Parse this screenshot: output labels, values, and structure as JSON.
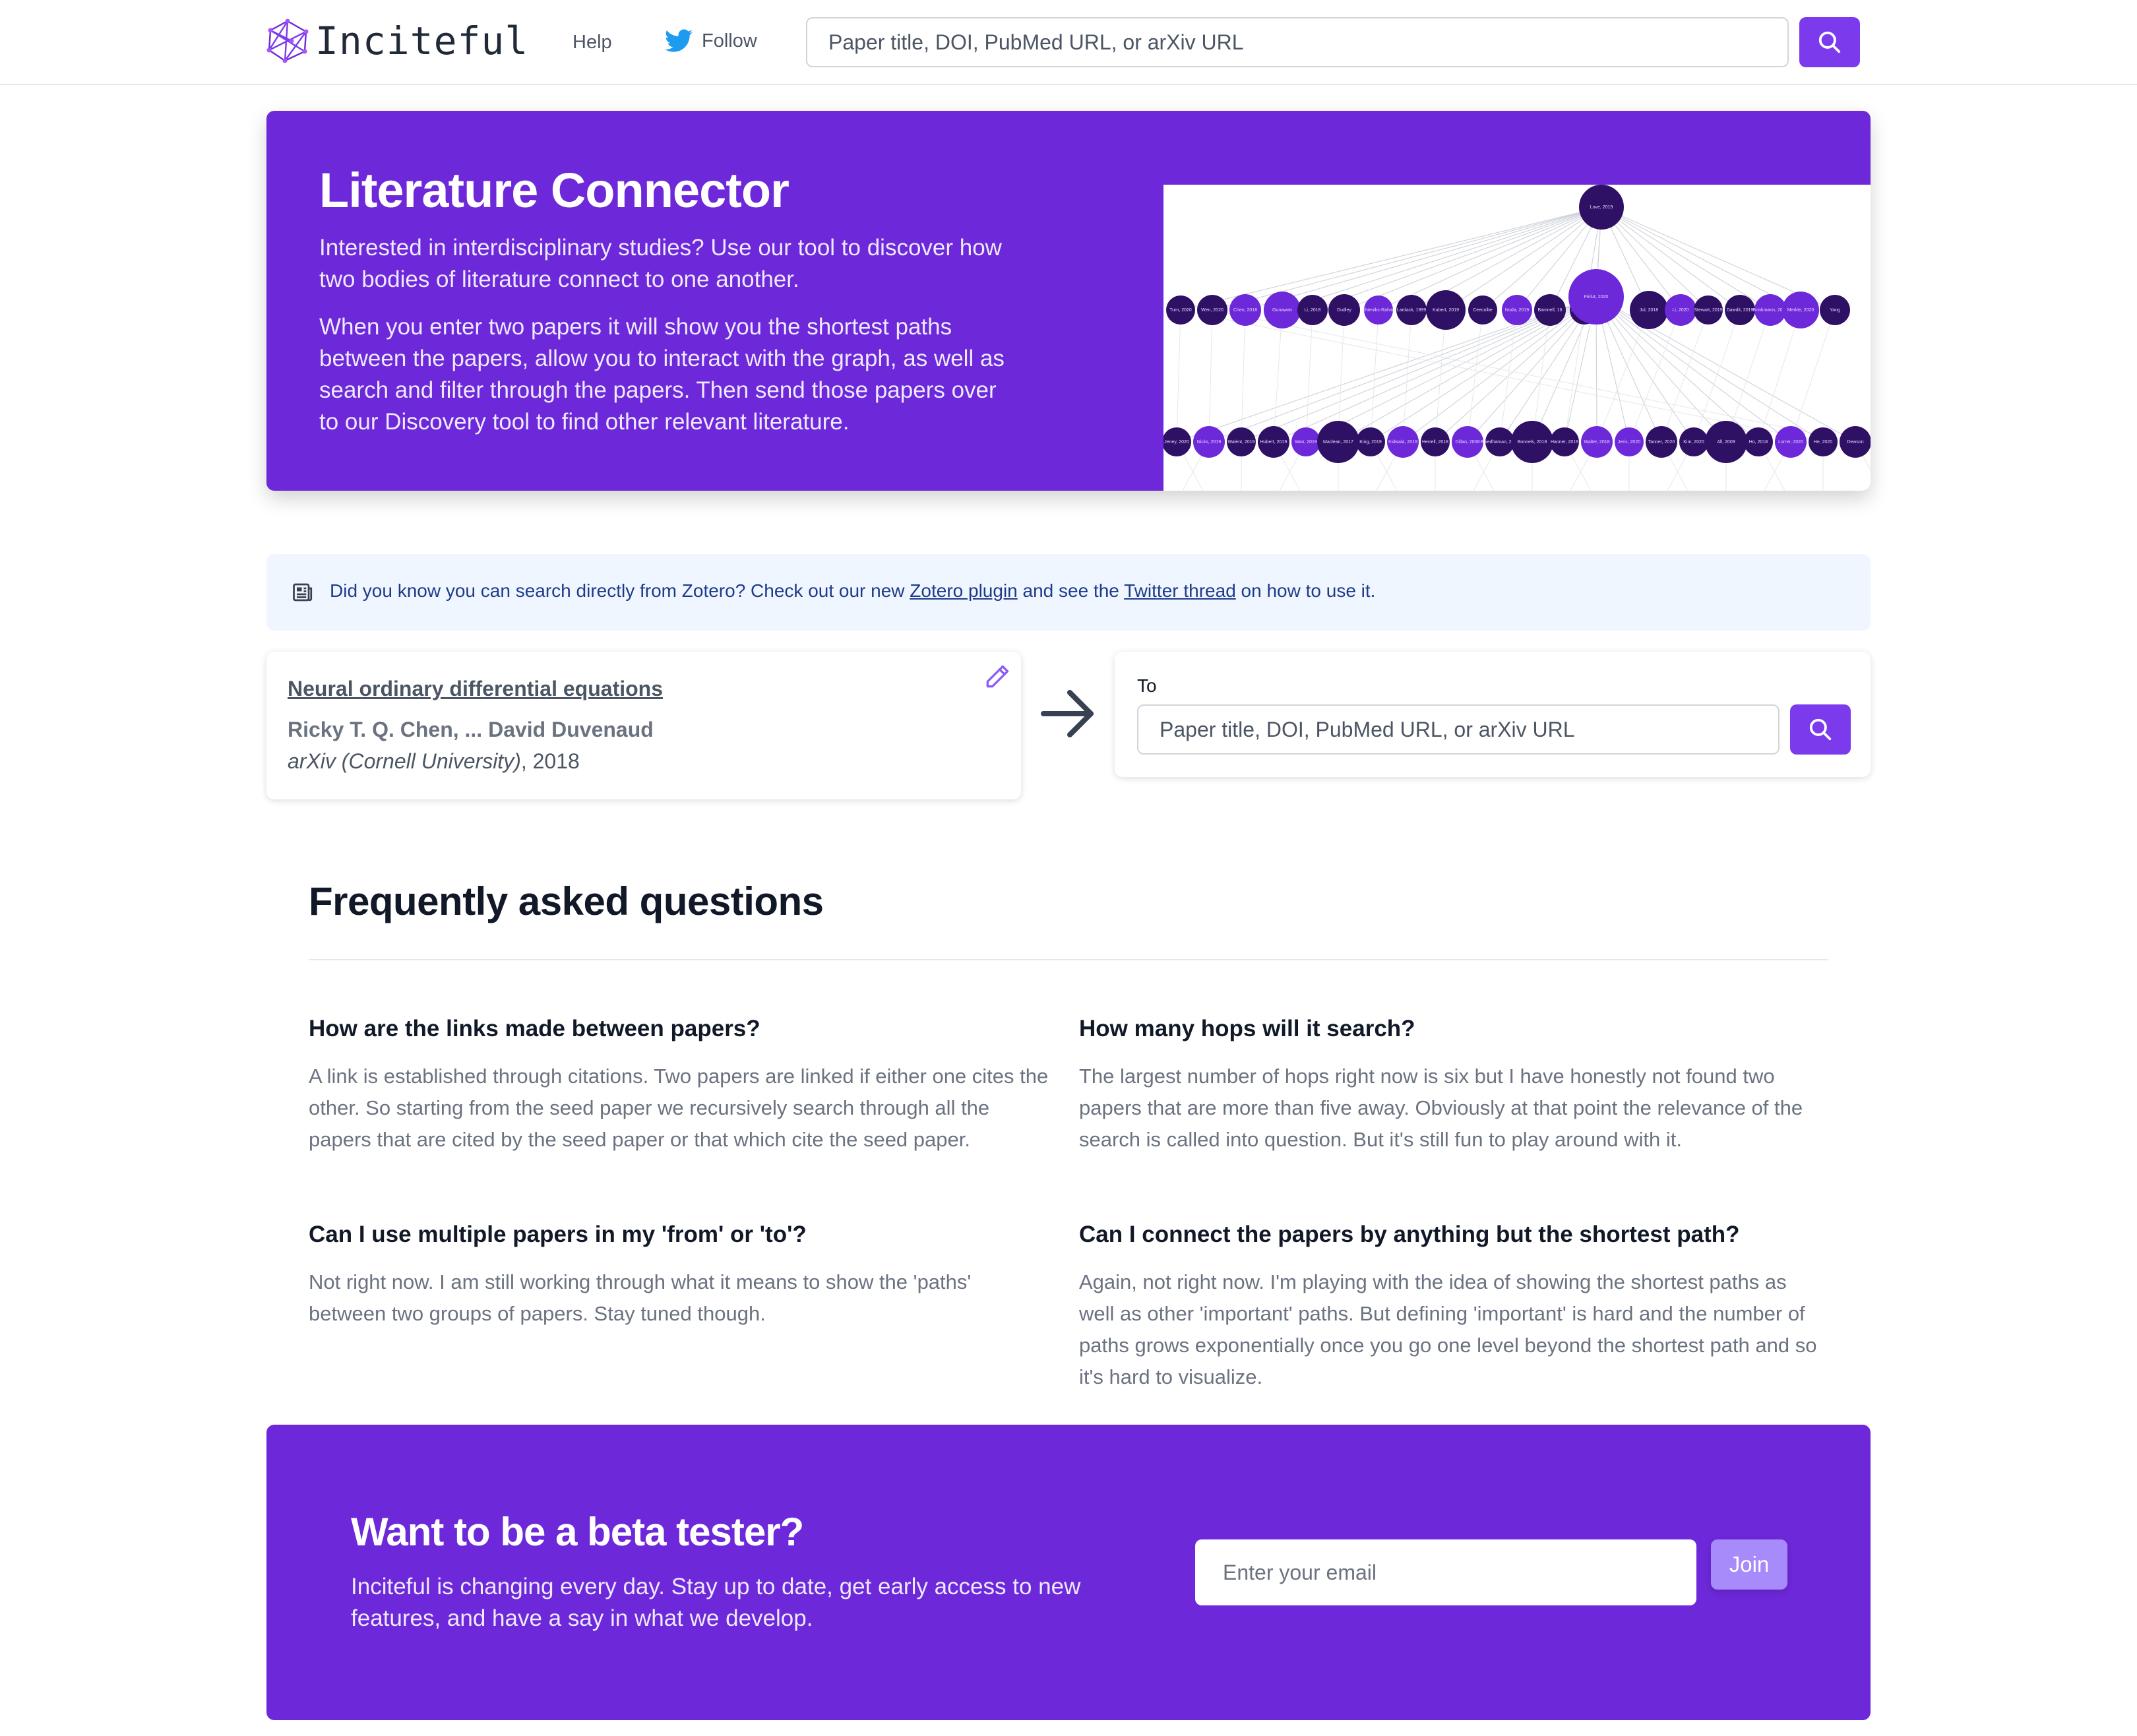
{
  "header": {
    "logo_text": "Inciteful",
    "help_label": "Help",
    "follow_label": "Follow",
    "search_placeholder": "Paper title, DOI, PubMed URL, or arXiv URL"
  },
  "hero": {
    "title": "Literature Connector",
    "p1": "Interested in interdisciplinary studies? Use our tool to discover how two bodies of literature connect to one another.",
    "p2": "When you enter two papers it will show you the shortest paths between the papers, allow you to interact with the graph, as well as search and filter through the papers. Then send those papers over to our Discovery tool to find other relevant literature.",
    "graph": {
      "top_node": "Love, 2019",
      "hub_node": "Finlut, 2020",
      "row1_labels": [
        "Turn, 2020",
        "Wen, 2020",
        "Chen, 2018",
        "Gunawan",
        "Li, 2018",
        "Dudley",
        "Shieniks-Rahari",
        "Lardack, 1999",
        "Kubert, 2019",
        "Ceecolbe",
        "Noda, 2019",
        "Bamnell, 16",
        "James, 2019",
        "Jul, 2018",
        "Li, 2020",
        "Stewart, 2019",
        "Dawdit, 2019",
        "Brinkmann, 2018",
        "Merkle, 2020",
        "Yang"
      ],
      "row2_labels": [
        "Jeney, 2020",
        "Nicks, 2019",
        "Walent, 2019",
        "Hubert, 2019",
        "Wan, 2019",
        "Maclean, 2017",
        "King, 2019",
        "Kidwala, 2019",
        "Herrell, 2018",
        "Dillan, 2008",
        "Buiedhaman, 2008",
        "Bonnels, 2018",
        "Hanner, 2019",
        "Walter, 2018",
        "Jeris, 2020",
        "Tanner, 2020",
        "Kim, 2020",
        "All, 2009",
        "Ho, 2018",
        "Lorrer, 2020",
        "He, 2020",
        "Dewson"
      ]
    }
  },
  "alert": {
    "text_before": "Did you know you can search directly from Zotero? Check out our new ",
    "link1": "Zotero plugin",
    "text_middle": " and see the ",
    "link2": "Twitter thread",
    "text_after": " on how to use it."
  },
  "from_paper": {
    "title": "Neural ordinary differential equations",
    "authors": "Ricky T. Q. Chen, ... David Duvenaud",
    "venue": "arXiv (Cornell University)",
    "year_suffix": ", 2018"
  },
  "to_box": {
    "label": "To",
    "placeholder": "Paper title, DOI, PubMed URL, or arXiv URL"
  },
  "faq": {
    "title": "Frequently asked questions",
    "items": [
      {
        "q": "How are the links made between papers?",
        "a": "A link is established through citations. Two papers are linked if either one cites the other. So starting from the seed paper we recursively search through all the papers that are cited by the seed paper or that which cite the seed paper."
      },
      {
        "q": "How many hops will it search?",
        "a": "The largest number of hops right now is six but I have honestly not found two papers that are more than five away. Obviously at that point the relevance of the search is called into question. But it's still fun to play around with it."
      },
      {
        "q": "Can I use multiple papers in my 'from' or 'to'?",
        "a": "Not right now. I am still working through what it means to show the 'paths' between two groups of papers. Stay tuned though."
      },
      {
        "q": "Can I connect the papers by anything but the shortest path?",
        "a": "Again, not right now. I'm playing with the idea of showing the shortest paths as well as other 'important' paths. But defining 'important' is hard and the number of paths grows exponentially once you go one level beyond the shortest path and so it's hard to visualize."
      }
    ]
  },
  "beta": {
    "title": "Want to be a beta tester?",
    "text": "Inciteful is changing every day. Stay up to date, get early access to new features, and have a say in what we develop.",
    "email_placeholder": "Enter your email",
    "join_label": "Join"
  },
  "colors": {
    "brand": "#6d28d9",
    "button": "#7c3aed",
    "node_dark": "#2e1065",
    "node_bright": "#6d28d9"
  }
}
